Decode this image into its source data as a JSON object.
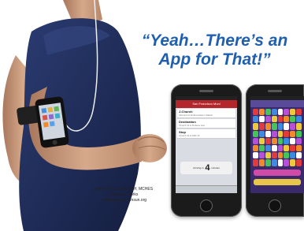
{
  "title": {
    "line1": "“Yeah…There’s an",
    "line2": "App for That!”"
  },
  "credit": {
    "name": "Abby DiPasquale, MPH, MCHES",
    "program": "Wellness Works",
    "email": "adipasquale@mmsun.org"
  },
  "colors": {
    "title": "#1f5fb0",
    "skin": "#c99a7d",
    "shirt": "#1d2a55",
    "map_navbar": "#b3262c",
    "game_bg": "#3a2a6b"
  },
  "phone_map": {
    "navbar_title": "San Francisco Muni",
    "rows": [
      {
        "label": "J-Church",
        "sub": "Inbound to Embarcadero Station"
      },
      {
        "label": "Destination",
        "sub": "Church St & Duboce Ave"
      },
      {
        "label": "Stop",
        "sub": "Church St & 18th St"
      }
    ],
    "arrival_prefix": "Arriving in",
    "arrival_number": "4",
    "arrival_suffix": "minutes"
  },
  "phone_game": {
    "gem_colors": [
      "#e23b3b",
      "#3b8be2",
      "#f0c93a",
      "#45c45a",
      "#b84fd8",
      "#f08a2a",
      "#ffffff"
    ]
  },
  "icons": [
    "armband-phone-icon"
  ]
}
